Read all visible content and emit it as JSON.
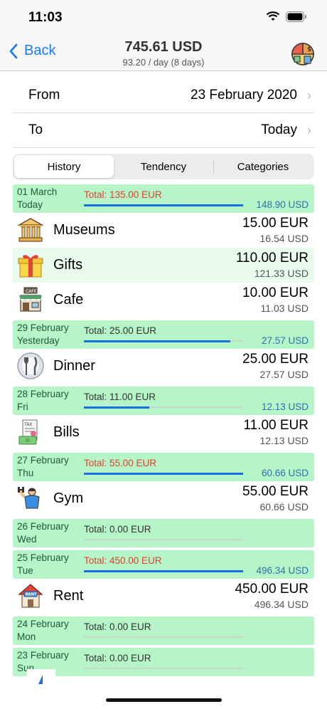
{
  "status": {
    "time": "11:03"
  },
  "nav": {
    "back_label": "Back",
    "title": "745.61 USD",
    "subtitle": "93.20 / day (8 days)"
  },
  "range": {
    "from_label": "From",
    "from_value": "23 February 2020",
    "to_label": "To",
    "to_value": "Today"
  },
  "tabs": [
    "History",
    "Tendency",
    "Categories"
  ],
  "active_tab": "History",
  "colors": {
    "accent": "#1a7cf5",
    "day_bg": "#b5f5c8",
    "progress": "#1a6fe0",
    "over_budget": "#e0412f"
  },
  "days": [
    {
      "date": "01 March",
      "weekday": "Today",
      "total": "Total: 135.00 EUR",
      "over": true,
      "progress": 1.0,
      "usd": "148.90 USD",
      "items": [
        {
          "name": "Museums",
          "icon": "museum-icon",
          "amount": "15.00 EUR",
          "usd": "16.54 USD",
          "hl": false
        },
        {
          "name": "Gifts",
          "icon": "gift-icon",
          "amount": "110.00 EUR",
          "usd": "121.33 USD",
          "hl": true
        },
        {
          "name": "Cafe",
          "icon": "cafe-icon",
          "amount": "10.00 EUR",
          "usd": "11.03 USD",
          "hl": false
        }
      ]
    },
    {
      "date": "29 February",
      "weekday": "Yesterday",
      "total": "Total: 25.00 EUR",
      "over": false,
      "progress": 0.92,
      "usd": "27.57 USD",
      "items": [
        {
          "name": "Dinner",
          "icon": "dinner-icon",
          "amount": "25.00 EUR",
          "usd": "27.57 USD",
          "hl": false
        }
      ]
    },
    {
      "date": "28 February",
      "weekday": "Fri",
      "total": "Total: 11.00 EUR",
      "over": false,
      "progress": 0.41,
      "usd": "12.13 USD",
      "items": [
        {
          "name": "Bills",
          "icon": "bills-icon",
          "amount": "11.00 EUR",
          "usd": "12.13 USD",
          "hl": false
        }
      ]
    },
    {
      "date": "27 February",
      "weekday": "Thu",
      "total": "Total: 55.00 EUR",
      "over": true,
      "progress": 1.0,
      "usd": "60.66 USD",
      "items": [
        {
          "name": "Gym",
          "icon": "gym-icon",
          "amount": "55.00 EUR",
          "usd": "60.66 USD",
          "hl": false
        }
      ]
    },
    {
      "date": "26 February",
      "weekday": "Wed",
      "total": "Total: 0.00 EUR",
      "over": false,
      "progress": 0,
      "usd": "",
      "items": []
    },
    {
      "date": "25 February",
      "weekday": "Tue",
      "total": "Total: 450.00 EUR",
      "over": true,
      "progress": 1.0,
      "usd": "496.34 USD",
      "items": [
        {
          "name": "Rent",
          "icon": "rent-icon",
          "amount": "450.00 EUR",
          "usd": "496.34 USD",
          "hl": false
        }
      ]
    },
    {
      "date": "24 February",
      "weekday": "Mon",
      "total": "Total: 0.00 EUR",
      "over": false,
      "progress": 0,
      "usd": "",
      "items": []
    },
    {
      "date": "23 February",
      "weekday": "Sun",
      "total": "Total: 0.00 EUR",
      "over": false,
      "progress": 0,
      "usd": "",
      "items": []
    }
  ]
}
